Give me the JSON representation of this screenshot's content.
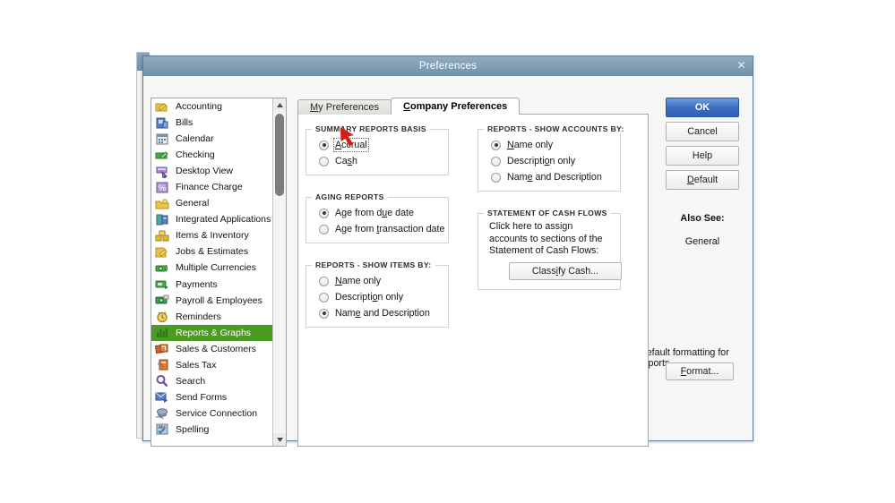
{
  "background_window": {
    "title": ""
  },
  "dialog": {
    "title": "Preferences",
    "close_label": "✕"
  },
  "sidebar": {
    "selected": "Reports & Graphs",
    "items": [
      {
        "label": "Accounting",
        "icon": "accounting-icon"
      },
      {
        "label": "Bills",
        "icon": "bills-icon"
      },
      {
        "label": "Calendar",
        "icon": "calendar-icon"
      },
      {
        "label": "Checking",
        "icon": "checking-icon"
      },
      {
        "label": "Desktop View",
        "icon": "desktop-view-icon"
      },
      {
        "label": "Finance Charge",
        "icon": "finance-charge-icon"
      },
      {
        "label": "General",
        "icon": "general-icon"
      },
      {
        "label": "Integrated Applications",
        "icon": "integrated-applications-icon"
      },
      {
        "label": "Items & Inventory",
        "icon": "items-inventory-icon"
      },
      {
        "label": "Jobs & Estimates",
        "icon": "jobs-estimates-icon"
      },
      {
        "label": "Multiple Currencies",
        "icon": "multiple-currencies-icon"
      },
      {
        "label": "Payments",
        "icon": "payments-icon"
      },
      {
        "label": "Payroll & Employees",
        "icon": "payroll-employees-icon"
      },
      {
        "label": "Reminders",
        "icon": "reminders-icon"
      },
      {
        "label": "Reports & Graphs",
        "icon": "reports-graphs-icon"
      },
      {
        "label": "Sales & Customers",
        "icon": "sales-customers-icon"
      },
      {
        "label": "Sales Tax",
        "icon": "sales-tax-icon"
      },
      {
        "label": "Search",
        "icon": "search-icon"
      },
      {
        "label": "Send Forms",
        "icon": "send-forms-icon"
      },
      {
        "label": "Service Connection",
        "icon": "service-connection-icon"
      },
      {
        "label": "Spelling",
        "icon": "spelling-icon"
      }
    ]
  },
  "tabs": [
    {
      "label": "My Preferences",
      "accel": "M",
      "active": false
    },
    {
      "label": "Company Preferences",
      "accel": "C",
      "active": true
    }
  ],
  "panel": {
    "summary_reports_basis": {
      "legend": "SUMMARY REPORTS BASIS",
      "options": [
        {
          "label": "Accrual",
          "accel": "A",
          "selected": true,
          "focused": true
        },
        {
          "label": "Cash",
          "accel": "s",
          "selected": false,
          "focused": false
        }
      ]
    },
    "aging_reports": {
      "legend": "AGING REPORTS",
      "options": [
        {
          "label": "Age from due date",
          "accel": "u",
          "selected": true
        },
        {
          "label": "Age from transaction date",
          "accel": "t",
          "selected": false
        }
      ]
    },
    "reports_show_items_by": {
      "legend": "REPORTS - SHOW ITEMS BY:",
      "options": [
        {
          "label": "Name only",
          "accel": "N",
          "selected": false
        },
        {
          "label": "Description only",
          "accel": "o",
          "selected": false
        },
        {
          "label": "Name and Description",
          "accel": "e",
          "selected": true
        }
      ]
    },
    "reports_show_accounts_by": {
      "legend": "REPORTS -  SHOW ACCOUNTS BY:",
      "options": [
        {
          "label": "Name only",
          "accel": "N",
          "selected": true
        },
        {
          "label": "Description only",
          "accel": "o",
          "selected": false
        },
        {
          "label": "Name and Description",
          "accel": "e",
          "selected": false
        }
      ]
    },
    "statement_of_cash_flows": {
      "legend": "STATEMENT OF CASH FLOWS",
      "text": "Click here to assign accounts to sections of the Statement of Cash Flows:",
      "button": "Classify Cash...",
      "button_accel": "i"
    },
    "default_formatting": {
      "label": "Default formatting for reports",
      "checked": false,
      "format_button": "Format...",
      "format_accel": "F"
    }
  },
  "right_buttons": {
    "ok": "OK",
    "cancel": "Cancel",
    "help": "Help",
    "default": "Default",
    "default_accel": "D",
    "also_see_title": "Also See:",
    "also_see_link": "General"
  },
  "annotation": {
    "arrow_color": "#d31f12",
    "points_at": "Cash"
  },
  "colors": {
    "titlebar": "#7e9ab0",
    "selection_green": "#4a9b1f",
    "primary_button": "#3d6fc4",
    "dialog_bg": "#f6f6f4"
  }
}
